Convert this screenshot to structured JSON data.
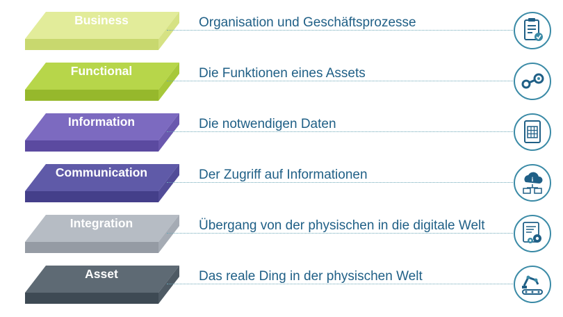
{
  "layers": [
    {
      "label": "Business",
      "description": "Organisation und Geschäftsprozesse",
      "icon": "clipboard-check-icon",
      "colors": {
        "top": "#e2ec9a",
        "front": "#c8d86e",
        "side": "#d6e284"
      }
    },
    {
      "label": "Functional",
      "description": "Die Funktionen eines Assets",
      "icon": "steam-pipes-icon",
      "colors": {
        "top": "#b7d64a",
        "front": "#96b82c",
        "side": "#a7c83a"
      }
    },
    {
      "label": "Information",
      "description": "Die notwendigen Daten",
      "icon": "spreadsheet-document-icon",
      "colors": {
        "top": "#7c6ac0",
        "front": "#5b4aa0",
        "side": "#6a58ae"
      }
    },
    {
      "label": "Communication",
      "description": "Der Zugriff auf Informationen",
      "icon": "cloud-network-icon",
      "colors": {
        "top": "#5f5aa8",
        "front": "#443f8a",
        "side": "#524c98"
      }
    },
    {
      "label": "Integration",
      "description": "Übergang von der physischen in die digitale Welt",
      "icon": "data-gears-icon",
      "colors": {
        "top": "#b6bcc4",
        "front": "#959ba4",
        "side": "#a5abb4"
      }
    },
    {
      "label": "Asset",
      "description": "Das reale Ding in der physischen Welt",
      "icon": "robot-conveyor-icon",
      "colors": {
        "top": "#5e6a74",
        "front": "#3e4a54",
        "side": "#4e5a64"
      }
    }
  ],
  "icon_ring_color": "#3a8aa6"
}
